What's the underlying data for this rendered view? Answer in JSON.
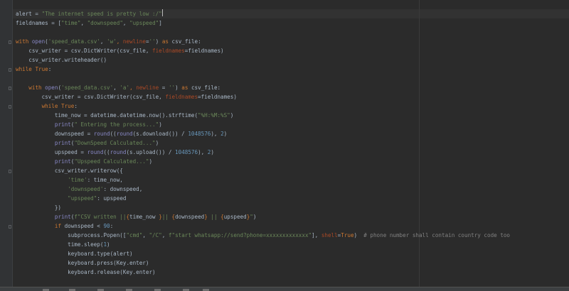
{
  "editor": {
    "colors": {
      "background": "#2b2b2b",
      "gutter": "#313335",
      "current_line": "#323232",
      "default_text": "#a9b7c6",
      "keyword": "#cc7832",
      "string": "#6a8759",
      "named_arg": "#aa4926",
      "builtin": "#8888c6",
      "number": "#6897bb",
      "comment": "#808080",
      "fstring_brace": "#cc7832"
    },
    "lines": [
      [
        [
          "t",
          "alert = "
        ],
        [
          "s",
          "\"The internet speed is pretty low :/\""
        ],
        [
          "caret",
          ""
        ]
      ],
      [
        [
          "t",
          "fieldnames = ["
        ],
        [
          "s",
          "\"time\""
        ],
        [
          "t",
          ", "
        ],
        [
          "s",
          "\"downspeed\""
        ],
        [
          "t",
          ", "
        ],
        [
          "s",
          "\"upspeed\""
        ],
        [
          "t",
          "]"
        ]
      ],
      [],
      [
        [
          "k",
          "with "
        ],
        [
          "b",
          "open"
        ],
        [
          "t",
          "("
        ],
        [
          "s",
          "'speed_data.csv'"
        ],
        [
          "t",
          ", "
        ],
        [
          "s",
          "'w'"
        ],
        [
          "k",
          ","
        ],
        [
          "t",
          " "
        ],
        [
          "n",
          "newline"
        ],
        [
          "t",
          "="
        ],
        [
          "s",
          "''"
        ],
        [
          "t",
          ") "
        ],
        [
          "k",
          "as "
        ],
        [
          "t",
          "csv_file:"
        ]
      ],
      [
        [
          "t",
          "    csv_writer = csv.DictWriter(csv_file, "
        ],
        [
          "n",
          "fieldnames"
        ],
        [
          "t",
          "=fieldnames)"
        ]
      ],
      [
        [
          "t",
          "    csv_writer.writeheader()"
        ]
      ],
      [
        [
          "k",
          "while "
        ],
        [
          "k",
          "True"
        ],
        [
          "t",
          ":"
        ]
      ],
      [],
      [
        [
          "t",
          "    "
        ],
        [
          "k",
          "with "
        ],
        [
          "b",
          "open"
        ],
        [
          "t",
          "("
        ],
        [
          "s",
          "'speed_data.csv'"
        ],
        [
          "t",
          ", "
        ],
        [
          "s",
          "'a'"
        ],
        [
          "k",
          ", "
        ],
        [
          "n",
          "newline"
        ],
        [
          "t",
          " = "
        ],
        [
          "s",
          "''"
        ],
        [
          "t",
          ") "
        ],
        [
          "k",
          "as "
        ],
        [
          "t",
          "csv_file:"
        ]
      ],
      [
        [
          "t",
          "        csv_writer = csv.DictWriter(csv_file, "
        ],
        [
          "n",
          "fieldnames"
        ],
        [
          "t",
          "=fieldnames)"
        ]
      ],
      [
        [
          "t",
          "        "
        ],
        [
          "k",
          "while "
        ],
        [
          "k",
          "True"
        ],
        [
          "t",
          ":"
        ]
      ],
      [
        [
          "t",
          "            time_now = datetime.datetime.now().strftime("
        ],
        [
          "s",
          "\"%H:%M:%S\""
        ],
        [
          "t",
          ")"
        ]
      ],
      [
        [
          "t",
          "            "
        ],
        [
          "b",
          "print"
        ],
        [
          "t",
          "("
        ],
        [
          "s",
          "\" Entering the process...\""
        ],
        [
          "t",
          ")"
        ]
      ],
      [
        [
          "t",
          "            downspeed = "
        ],
        [
          "b",
          "round"
        ],
        [
          "t",
          "(("
        ],
        [
          "b",
          "round"
        ],
        [
          "t",
          "(s.download()) / "
        ],
        [
          "m",
          "1048576"
        ],
        [
          "t",
          "), "
        ],
        [
          "m",
          "2"
        ],
        [
          "t",
          ")"
        ]
      ],
      [
        [
          "t",
          "            "
        ],
        [
          "b",
          "print"
        ],
        [
          "t",
          "("
        ],
        [
          "s",
          "\"DownSpeed Calculated...\""
        ],
        [
          "t",
          ")"
        ]
      ],
      [
        [
          "t",
          "            upspeed = "
        ],
        [
          "b",
          "round"
        ],
        [
          "t",
          "(("
        ],
        [
          "b",
          "round"
        ],
        [
          "t",
          "(s.upload()) / "
        ],
        [
          "m",
          "1048576"
        ],
        [
          "t",
          "), "
        ],
        [
          "m",
          "2"
        ],
        [
          "t",
          ")"
        ]
      ],
      [
        [
          "t",
          "            "
        ],
        [
          "b",
          "print"
        ],
        [
          "t",
          "("
        ],
        [
          "s",
          "\"Upspeed Calculated...\""
        ],
        [
          "t",
          ")"
        ]
      ],
      [
        [
          "t",
          "            csv_writer.writerow({"
        ]
      ],
      [
        [
          "t",
          "                "
        ],
        [
          "s",
          "'time'"
        ],
        [
          "t",
          ": time_now,"
        ]
      ],
      [
        [
          "t",
          "                "
        ],
        [
          "s",
          "'downspeed'"
        ],
        [
          "t",
          ": downspeed,"
        ]
      ],
      [
        [
          "t",
          "                "
        ],
        [
          "s",
          "\"upspeed\""
        ],
        [
          "t",
          ": upspeed"
        ]
      ],
      [
        [
          "t",
          "            })"
        ]
      ],
      [
        [
          "t",
          "            "
        ],
        [
          "b",
          "print"
        ],
        [
          "t",
          "("
        ],
        [
          "s",
          "f\"CSV written ||"
        ],
        [
          "f",
          "{"
        ],
        [
          "t",
          "time_now "
        ],
        [
          "f",
          "}"
        ],
        [
          "s",
          "|| "
        ],
        [
          "f",
          "{"
        ],
        [
          "t",
          "downspeed"
        ],
        [
          "f",
          "}"
        ],
        [
          "s",
          " || "
        ],
        [
          "f",
          "{"
        ],
        [
          "t",
          "upspeed"
        ],
        [
          "f",
          "}"
        ],
        [
          "s",
          "\""
        ],
        [
          "t",
          ")"
        ]
      ],
      [
        [
          "t",
          "            "
        ],
        [
          "k",
          "if "
        ],
        [
          "t",
          "downspeed < "
        ],
        [
          "m",
          "90"
        ],
        [
          "t",
          ":"
        ]
      ],
      [
        [
          "t",
          "                subprocess.Popen(["
        ],
        [
          "s",
          "\"cmd\""
        ],
        [
          "t",
          ", "
        ],
        [
          "s",
          "\"/C\""
        ],
        [
          "t",
          ", "
        ],
        [
          "s",
          "f\"start whatsapp://send?phone=xxxxxxxxxxxxx\""
        ],
        [
          "t",
          "], "
        ],
        [
          "n",
          "shell"
        ],
        [
          "t",
          "="
        ],
        [
          "k",
          "True"
        ],
        [
          "t",
          ")"
        ],
        [
          "c",
          "  # phone number shall contain country code too"
        ]
      ],
      [
        [
          "t",
          "                time.sleep("
        ],
        [
          "m",
          "1"
        ],
        [
          "t",
          ")"
        ]
      ],
      [
        [
          "t",
          "                keyboard.type(alert)"
        ]
      ],
      [
        [
          "t",
          "                keyboard.press(Key.enter)"
        ]
      ],
      [
        [
          "t",
          "                keyboard.release(Key.enter)"
        ]
      ]
    ]
  }
}
